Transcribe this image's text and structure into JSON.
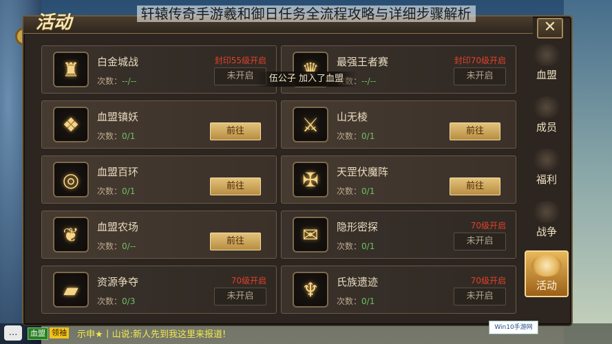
{
  "banner_title": "轩辕传奇手游羲和御日任务全流程攻略与详细步骤解析",
  "panel": {
    "title": "活动",
    "close_icon": "close-icon"
  },
  "toast": "伍公子 加入了血盟",
  "activities": [
    {
      "name": "白金城战",
      "count_label": "次数：",
      "count": "--/--",
      "req": "封印55级开启",
      "action": "未开启",
      "state": "locked",
      "icon": "fortress-icon",
      "glyph": "♜"
    },
    {
      "name": "最强王者赛",
      "count_label": "次数：",
      "count": "--/--",
      "req": "封印70级开启",
      "action": "未开启",
      "state": "locked",
      "icon": "crown-icon",
      "glyph": "♛"
    },
    {
      "name": "血盟镇妖",
      "count_label": "次数：",
      "count": "0/1",
      "req": "",
      "action": "前往",
      "state": "open",
      "icon": "fox-icon",
      "glyph": "❖"
    },
    {
      "name": "山无棱",
      "count_label": "次数：",
      "count": "0/1",
      "req": "",
      "action": "前往",
      "state": "open",
      "icon": "crossed-swords-icon",
      "glyph": "⚔"
    },
    {
      "name": "血盟百环",
      "count_label": "次数：",
      "count": "0/1",
      "req": "",
      "action": "前往",
      "state": "open",
      "icon": "rings-icon",
      "glyph": "◎"
    },
    {
      "name": "天罡伏魔阵",
      "count_label": "次数：",
      "count": "0/1",
      "req": "",
      "action": "前往",
      "state": "open",
      "icon": "formation-icon",
      "glyph": "✠"
    },
    {
      "name": "血盟农场",
      "count_label": "次数：",
      "count": "0/--",
      "req": "",
      "action": "前往",
      "state": "open",
      "icon": "sprout-icon",
      "glyph": "❦"
    },
    {
      "name": "隐形密探",
      "count_label": "次数：",
      "count": "0/1",
      "req": "70级开启",
      "action": "未开启",
      "state": "locked",
      "icon": "envelope-icon",
      "glyph": "✉"
    },
    {
      "name": "资源争夺",
      "count_label": "次数：",
      "count": "0/3",
      "req": "70级开启",
      "action": "未开启",
      "state": "locked",
      "icon": "gold-bar-icon",
      "glyph": "▰"
    },
    {
      "name": "氏族遗迹",
      "count_label": "次数：",
      "count": "0/1",
      "req": "70级开启",
      "action": "未开启",
      "state": "locked",
      "icon": "demon-mask-icon",
      "glyph": "♆"
    }
  ],
  "sidebar": [
    {
      "label": "血盟",
      "icon": "clan-banner-icon",
      "active": false
    },
    {
      "label": "成员",
      "icon": "members-icon",
      "active": false
    },
    {
      "label": "福利",
      "icon": "welfare-mask-icon",
      "active": false
    },
    {
      "label": "战争",
      "icon": "war-icon",
      "active": false
    },
    {
      "label": "活动",
      "icon": "horn-icon",
      "active": true
    }
  ],
  "chat": {
    "icon": "chat-bubble-icon",
    "channel": "血盟",
    "title": "领袖",
    "message": "示申★丨山说:新人先到我这里来报道!"
  },
  "watermark": "Win10手游网"
}
